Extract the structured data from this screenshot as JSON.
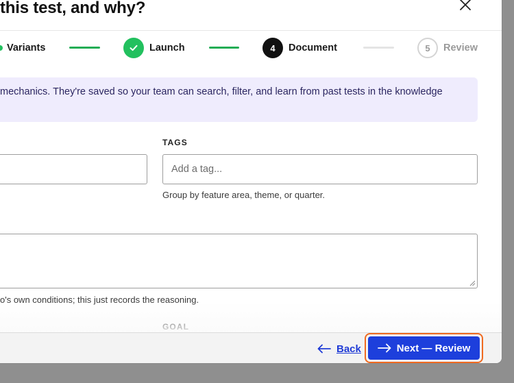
{
  "modal": {
    "title": "this test, and why?",
    "accent_color": "#1d3fdc",
    "success_color": "#22c05e"
  },
  "stepper": {
    "steps": [
      {
        "label": "Variants",
        "state": "done"
      },
      {
        "label": "Launch",
        "state": "done"
      },
      {
        "number": "4",
        "label": "Document",
        "state": "active"
      },
      {
        "number": "5",
        "label": "Review",
        "state": "upcoming"
      }
    ]
  },
  "banner": {
    "text": "mechanics. They're saved so your team can search, filter, and learn from past tests in the knowledge"
  },
  "tags": {
    "label": "TAGS",
    "placeholder": "Add a tag...",
    "help": "Group by feature area, theme, or quarter."
  },
  "reasoning": {
    "help": "o's own conditions; this just records the reasoning."
  },
  "goal": {
    "label": "GOAL"
  },
  "footer": {
    "back_label": "Back",
    "next_label": "Next — Review"
  }
}
